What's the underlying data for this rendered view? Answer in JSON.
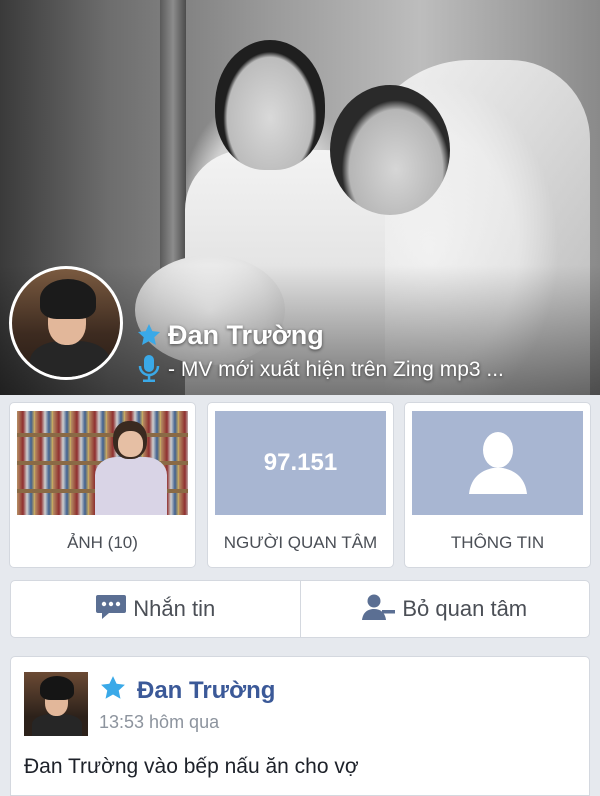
{
  "profile": {
    "name": "Đan Trường",
    "status": "- MV mới xuất hiện trên Zing mp3 ..."
  },
  "tiles": {
    "photos_label": "ẢNH (10)",
    "followers_count": "97.151",
    "followers_label": "NGƯỜI QUAN TÂM",
    "info_label": "THÔNG TIN"
  },
  "actions": {
    "message_label": "Nhắn tin",
    "unfollow_label": "Bỏ quan tâm"
  },
  "post": {
    "author": "Đan Trường",
    "time": "13:53 hôm qua",
    "text": "Đan Trường vào bếp nấu ăn cho vợ"
  },
  "icons": {
    "verified": "star-icon",
    "status": "microphone-icon",
    "message": "chat-bubble-icon",
    "unfollow": "person-minus-icon",
    "info": "person-silhouette-icon"
  },
  "colors": {
    "accent_star": "#3aa9e8",
    "tile_fill": "#a8b6d2",
    "author_link": "#3b5998",
    "text_muted": "#4b4f56"
  }
}
